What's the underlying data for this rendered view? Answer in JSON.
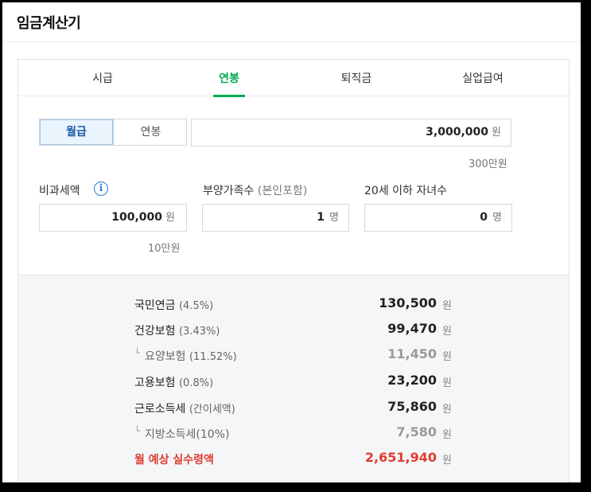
{
  "header": {
    "title": "임금계산기"
  },
  "tabs": [
    {
      "label": "시급"
    },
    {
      "label": "연봉",
      "active": true
    },
    {
      "label": "퇴직금"
    },
    {
      "label": "실업급여"
    }
  ],
  "pay_type": {
    "selected": "월급",
    "other": "연봉"
  },
  "salary": {
    "value": "3,000,000",
    "unit": "원",
    "hint": "300만원"
  },
  "tax_free": {
    "label": "비과세액",
    "value": "100,000",
    "unit": "원",
    "hint": "10만원"
  },
  "dependents": {
    "label": "부양가족수",
    "label_note": "(본인포함)",
    "value": "1",
    "unit": "명"
  },
  "children": {
    "label": "20세 이하 자녀수",
    "value": "0",
    "unit": "명"
  },
  "results": {
    "won": "원",
    "rows": [
      {
        "name": "국민연금",
        "pct": "(4.5%)",
        "amount": "130,500"
      },
      {
        "name": "건강보험",
        "pct": "(3.43%)",
        "amount": "99,470"
      },
      {
        "name": "요양보험",
        "pct": "(11.52%)",
        "amount": "11,450"
      },
      {
        "name": "고용보험",
        "pct": "(0.8%)",
        "amount": "23,200"
      },
      {
        "name": "근로소득세",
        "pct": "(간이세액)",
        "amount": "75,860"
      },
      {
        "name": "지방소득세(10%)",
        "pct": "",
        "amount": "7,580"
      },
      {
        "name": "월 예상 실수령액",
        "pct": "",
        "amount": "2,651,940"
      }
    ]
  },
  "colors": {
    "accent": "#03a94d",
    "selected_blue": "#1a5aa8",
    "total_red": "#e03c31"
  }
}
